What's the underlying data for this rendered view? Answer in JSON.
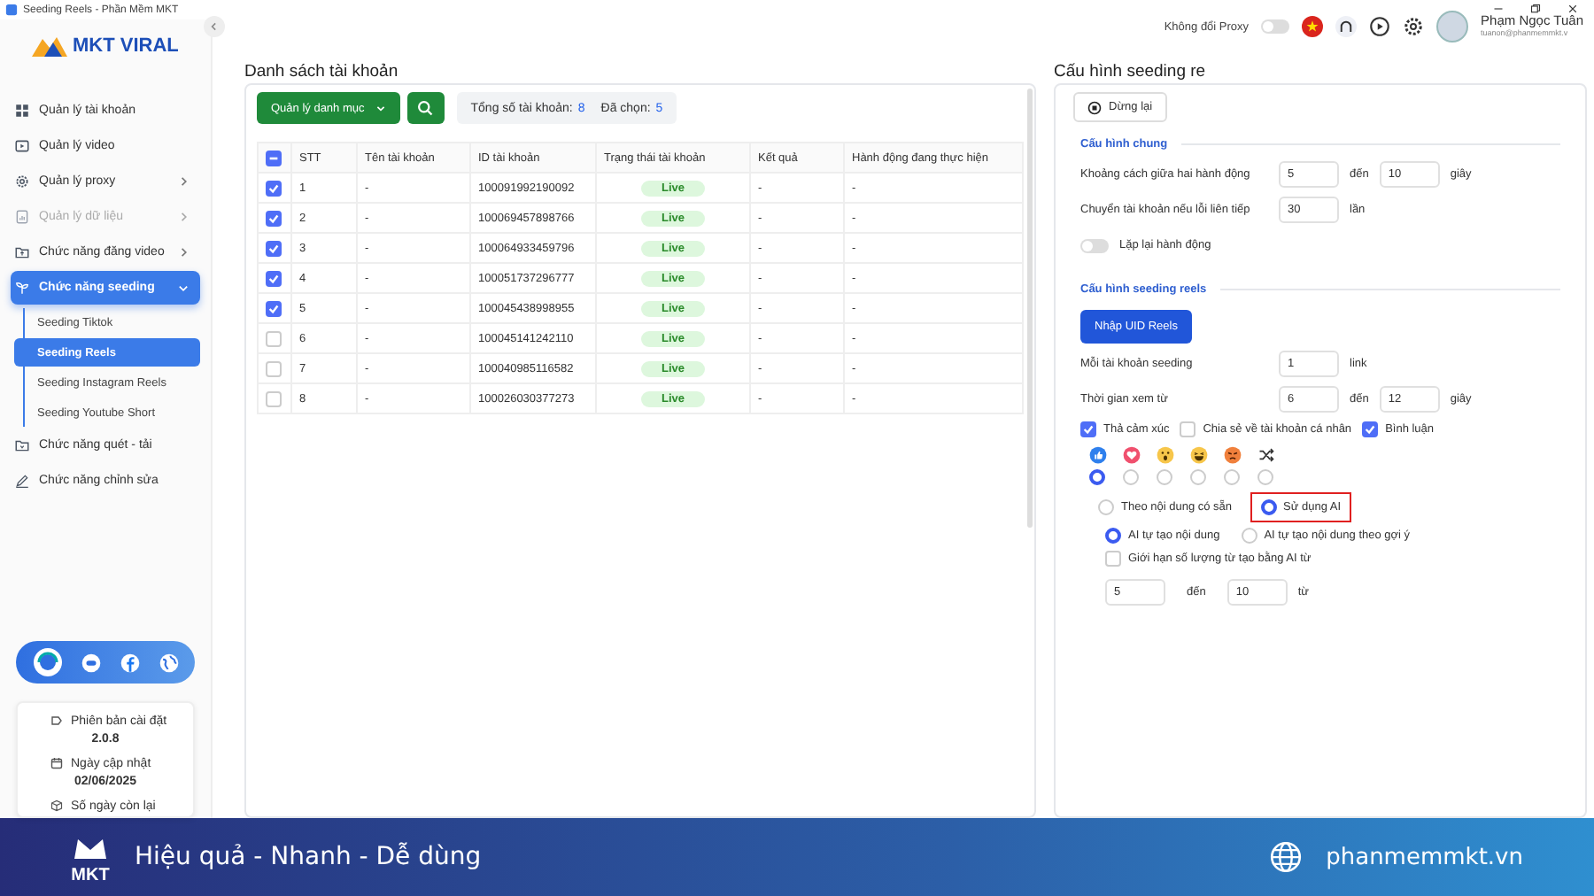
{
  "window": {
    "title": "Seeding Reels - Phần Mềm MKT"
  },
  "header": {
    "logo": "MKT VIRAL",
    "proxy_label": "Không đổi Proxy",
    "proxy_on": false,
    "user": {
      "name": "Phạm Ngọc Tuân",
      "email": "tuanon@phanmemmkt.v"
    }
  },
  "sidebar": {
    "items": [
      {
        "kind": "link",
        "label": "Quản lý tài khoản",
        "selected": false,
        "disabled": false
      },
      {
        "kind": "link",
        "label": "Quản lý video",
        "selected": false,
        "disabled": false
      },
      {
        "kind": "group",
        "label": "Quản lý proxy",
        "selected": false,
        "disabled": false,
        "expanded": false
      },
      {
        "kind": "group",
        "label": "Quản lý dữ liệu",
        "selected": false,
        "disabled": true,
        "expanded": false
      },
      {
        "kind": "group",
        "label": "Chức năng đăng video",
        "selected": false,
        "disabled": false,
        "expanded": false
      },
      {
        "kind": "group",
        "label": "Chức năng seeding",
        "selected": true,
        "disabled": false,
        "expanded": true,
        "children": [
          {
            "label": "Seeding Tiktok",
            "selected": false
          },
          {
            "label": "Seeding Reels",
            "selected": true
          },
          {
            "label": "Seeding Instagram Reels",
            "selected": false
          },
          {
            "label": "Seeding Youtube Short",
            "selected": false
          }
        ]
      },
      {
        "kind": "link",
        "label": "Chức năng quét - tải",
        "selected": false,
        "disabled": false
      },
      {
        "kind": "link",
        "label": "Chức năng chỉnh sửa",
        "selected": false,
        "disabled": false
      }
    ],
    "info": [
      {
        "label": "Phiên bản cài đặt",
        "value": "2.0.8"
      },
      {
        "label": "Ngày cập nhật",
        "value": "02/06/2025"
      },
      {
        "label": "Số ngày còn lại"
      }
    ]
  },
  "accounts": {
    "title": "Danh sách tài khoản",
    "category_button": "Quản lý danh mục",
    "total_label": "Tổng số tài khoản:",
    "total": "8",
    "selected_label": "Đã chọn:",
    "selected_count": "5",
    "table": {
      "partially_checked": true,
      "columns": [
        "STT",
        "Tên tài khoản",
        "ID tài khoản",
        "Trạng thái tài khoản",
        "Kết quả",
        "Hành động đang thực hiện"
      ],
      "rows": [
        {
          "checked": true,
          "cells": [
            "1",
            "-",
            "100091992190092",
            "Live",
            "-",
            "-"
          ]
        },
        {
          "checked": true,
          "cells": [
            "2",
            "-",
            "100069457898766",
            "Live",
            "-",
            "-"
          ]
        },
        {
          "checked": true,
          "cells": [
            "3",
            "-",
            "100064933459796",
            "Live",
            "-",
            "-"
          ]
        },
        {
          "checked": true,
          "cells": [
            "4",
            "-",
            "100051737296777",
            "Live",
            "-",
            "-"
          ]
        },
        {
          "checked": true,
          "cells": [
            "5",
            "-",
            "100045438998955",
            "Live",
            "-",
            "-"
          ]
        },
        {
          "checked": false,
          "cells": [
            "6",
            "-",
            "100045141242110",
            "Live",
            "-",
            "-"
          ]
        },
        {
          "checked": false,
          "cells": [
            "7",
            "-",
            "100040985116582",
            "Live",
            "-",
            "-"
          ]
        },
        {
          "checked": false,
          "cells": [
            "8",
            "-",
            "100026030377273",
            "Live",
            "-",
            "-"
          ]
        }
      ]
    }
  },
  "config": {
    "title": "Cấu hình seeding re",
    "stop_button": "Dừng lại",
    "general": {
      "title": "Cấu hình chung",
      "delay": {
        "label": "Khoảng cách giữa hai hành động",
        "from": "5",
        "to_label": "đến",
        "to": "10",
        "unit": "giây"
      },
      "switch_after": {
        "label": "Chuyển tài khoản nếu lỗi liên tiếp",
        "value": "30",
        "unit": "lần"
      },
      "repeat": {
        "label": "Lặp lại hành động",
        "on": false
      }
    },
    "reels": {
      "title": "Cấu hình seeding reels",
      "import_button": "Nhập UID Reels",
      "per_account": {
        "label": "Mỗi tài khoản seeding",
        "value": "1",
        "unit": "link"
      },
      "watch_time": {
        "label": "Thời gian xem từ",
        "from": "6",
        "to_label": "đến",
        "to": "12",
        "unit": "giây"
      },
      "options": [
        {
          "label": "Thả cảm xúc",
          "checked": true
        },
        {
          "label": "Chia sẻ về tài khoản cá nhân",
          "checked": false
        },
        {
          "label": "Bình luận",
          "checked": true
        }
      ],
      "reactions": [
        {
          "kind": "like",
          "selected": true
        },
        {
          "kind": "love",
          "selected": false
        },
        {
          "kind": "wow",
          "selected": false
        },
        {
          "kind": "haha",
          "selected": false
        },
        {
          "kind": "angry",
          "selected": false
        },
        {
          "kind": "random",
          "selected": false
        }
      ],
      "comment_source": [
        {
          "label": "Theo nội dung có sẵn",
          "selected": false,
          "highlighted": false
        },
        {
          "label": "Sử dụng AI",
          "selected": true,
          "highlighted": true
        }
      ],
      "ai_mode": [
        {
          "label": "AI tự tạo nội dung",
          "selected": true
        },
        {
          "label": "AI tự tạo nội dung theo gợi ý",
          "selected": false
        }
      ],
      "word_limit": {
        "label": "Giới hạn số lượng từ tạo bằng AI từ",
        "checked": false,
        "from": "5",
        "to_label": "đến",
        "to": "10",
        "unit": "từ"
      }
    }
  },
  "banner": {
    "logo": "MKT",
    "slogan": "Hiệu quả - Nhanh - Dễ dùng",
    "website": "phanmemmkt.vn"
  }
}
